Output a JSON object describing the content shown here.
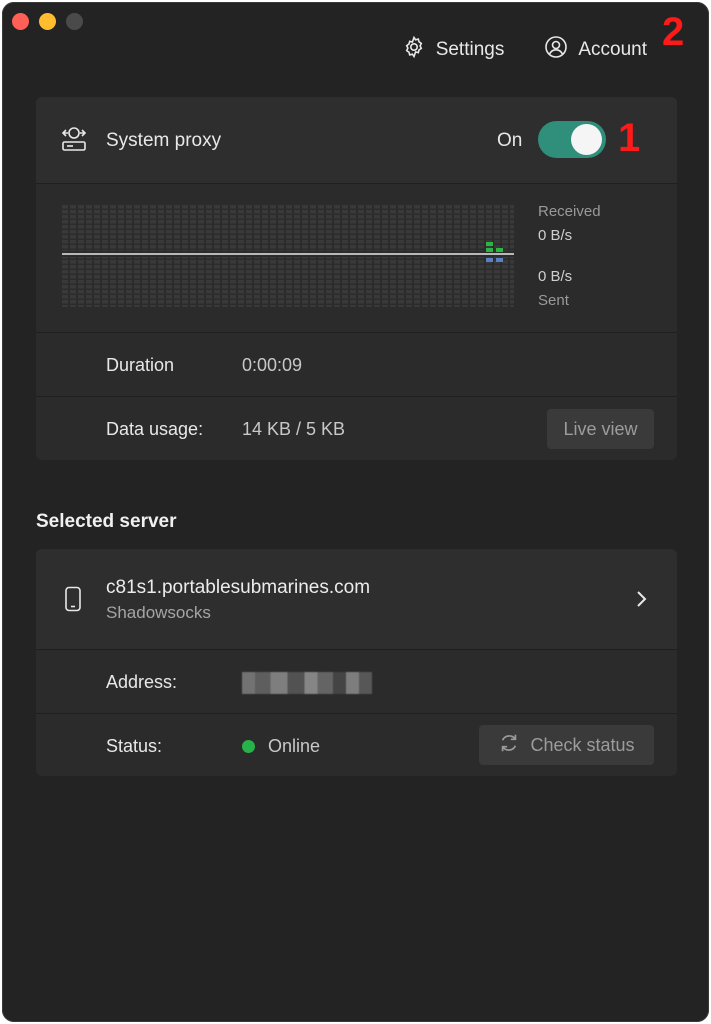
{
  "topnav": {
    "settings_label": "Settings",
    "account_label": "Account"
  },
  "markers": {
    "one": "1",
    "two": "2"
  },
  "proxy": {
    "title": "System proxy",
    "state_label": "On",
    "enabled": true,
    "accent_color": "#2f8f7a"
  },
  "traffic": {
    "received_label": "Received",
    "received_value": "0 B/s",
    "sent_value": "0 B/s",
    "sent_label": "Sent"
  },
  "stats": {
    "duration_label": "Duration",
    "duration_value": "0:00:09",
    "usage_label": "Data usage:",
    "usage_value": "14 KB / 5 KB",
    "live_view_label": "Live view"
  },
  "section": {
    "selected_server_title": "Selected server"
  },
  "server": {
    "name": "c81s1.portablesubmarines.com",
    "protocol": "Shadowsocks",
    "address_label": "Address:",
    "status_label": "Status:",
    "status_value": "Online",
    "status_color": "#27b24a",
    "check_status_label": "Check status"
  },
  "icons": [
    "gear-icon",
    "account-icon",
    "proxy-icon",
    "phone-icon",
    "chevron-right-icon",
    "refresh-icon"
  ]
}
